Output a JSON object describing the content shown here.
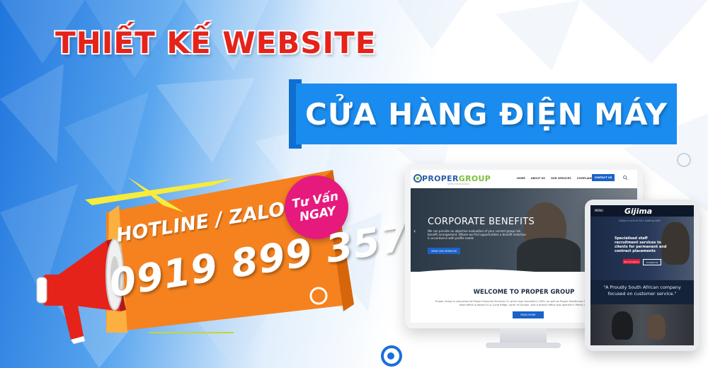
{
  "headline": {
    "line1": "THIẾT KẾ WEBSITE",
    "line2": "CỬA HÀNG ĐIỆN MÁY"
  },
  "cta": {
    "badge_line1": "Tư Vấn",
    "badge_line2": "NGAY",
    "hotline_label": "HOTLINE / ZALO",
    "phone": "0919 899 357"
  },
  "desktop_site": {
    "logo_main": "PROPER",
    "logo_accent": "GROUP",
    "logo_sub": "AFFECT HUB WORKS",
    "nav": [
      "HOME",
      "ABOUT US",
      "OUR SERVICES",
      "COMPLIANCE",
      "NEWS"
    ],
    "contact_button": "CONTACT US",
    "hero_title": "CORPORATE BENEFITS",
    "hero_text": "We can provide an objective evaluation of your current group risk benefit arrangement. Where we find opportunities a benefit selection in accordance with profile needs",
    "hero_button": "VIEW OUR SERVICES",
    "welcome_title": "WELCOME TO PROPER GROUP",
    "welcome_text": "Proper Group is comprised of Proper Financial Services CC which was founded in 1992, as well as Proper Healthcare Se... The Proper Group head office is based in La Lucia Ridge, north of Durban, and a branch office was opened in Merks in...",
    "read_more": "READ MORE"
  },
  "tablet_site": {
    "menu": "MENU",
    "logo": "Gijima",
    "tagline": "Gijima is one of SA's leading staff",
    "hero_text": "Specialised staff recruitment services to clients for permanent and contract placements",
    "button1": "Recruit Gijima",
    "button2": "Contact Us",
    "quote": "\"A Proudly South African company focused on customer service.\""
  },
  "colors": {
    "red": "#e5231b",
    "blue": "#1a8cf0",
    "orange": "#f5821f",
    "pink": "#e6197c"
  }
}
